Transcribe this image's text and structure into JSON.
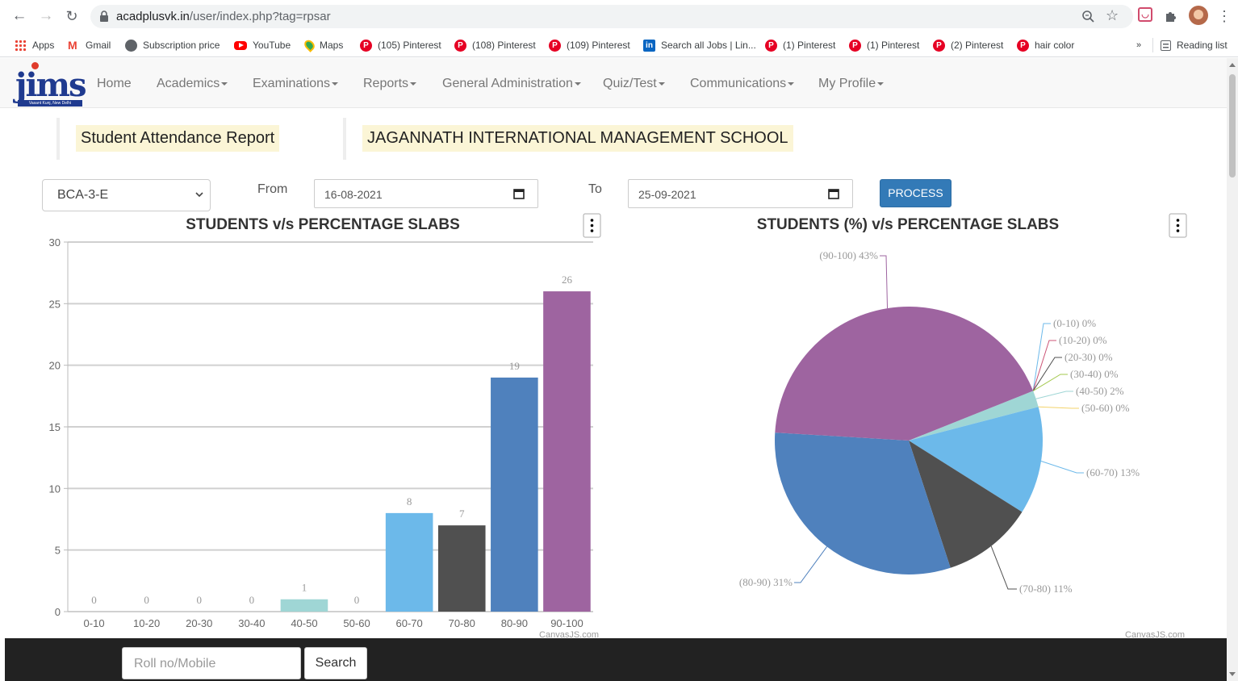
{
  "browser": {
    "url_host": "acadplusvk.in",
    "url_path": "/user/index.php?tag=rpsar",
    "bookmarks": [
      {
        "label": "Apps",
        "icon": "apps-grid-icon"
      },
      {
        "label": "Gmail",
        "icon": "gmail-icon"
      },
      {
        "label": "Subscription price",
        "icon": "globe-icon"
      },
      {
        "label": "YouTube",
        "icon": "youtube-icon"
      },
      {
        "label": "Maps",
        "icon": "maps-pin-icon"
      },
      {
        "label": "(105) Pinterest",
        "icon": "pinterest-icon"
      },
      {
        "label": "(108) Pinterest",
        "icon": "pinterest-icon"
      },
      {
        "label": "(109) Pinterest",
        "icon": "pinterest-icon"
      },
      {
        "label": "Search all Jobs | Lin...",
        "icon": "linkedin-icon"
      },
      {
        "label": "(1) Pinterest",
        "icon": "pinterest-icon"
      },
      {
        "label": "(1) Pinterest",
        "icon": "pinterest-icon"
      },
      {
        "label": "(2) Pinterest",
        "icon": "pinterest-icon"
      },
      {
        "label": "hair color",
        "icon": "pinterest-icon"
      }
    ],
    "overflow": "»",
    "reading_list": "Reading list"
  },
  "logo": {
    "text": "jims",
    "subtitle": "Vasant Kunj, New Delhi"
  },
  "nav": {
    "home": "Home",
    "academics": "Academics",
    "examinations": "Examinations",
    "reports": "Reports",
    "general_admin": "General Administration",
    "quiz": "Quiz/Test",
    "communications": "Communications",
    "profile": "My Profile"
  },
  "header": {
    "report_title": "Student Attendance Report",
    "school_name": "JAGANNATH INTERNATIONAL MANAGEMENT SCHOOL"
  },
  "filters": {
    "class_value": "BCA-3-E",
    "from_label": "From",
    "from_date": "16-08-2021",
    "to_label": "To",
    "to_date": "25-09-2021",
    "process_label": "PROCESS"
  },
  "chart_data": [
    {
      "type": "bar",
      "title": "STUDENTS v/s PERCENTAGE SLABS",
      "categories": [
        "0-10",
        "10-20",
        "20-30",
        "30-40",
        "40-50",
        "50-60",
        "60-70",
        "70-80",
        "80-90",
        "90-100"
      ],
      "values": [
        0,
        0,
        0,
        0,
        1,
        0,
        8,
        7,
        19,
        26
      ],
      "colors": [
        "#6cb9ea",
        "#505050",
        "#4f81bd",
        "#9e64a0",
        "#9fd6d5",
        "#f3d36b",
        "#6cb9ea",
        "#505050",
        "#4f81bd",
        "#9e64a0"
      ],
      "ylim": [
        0,
        30
      ],
      "yticks": [
        0,
        5,
        10,
        15,
        20,
        25,
        30
      ],
      "grid": true,
      "credit": "CanvasJS.com"
    },
    {
      "type": "pie",
      "title": "STUDENTS (%) v/s PERCENTAGE SLABS",
      "labels": [
        "(0-10) 0%",
        "(10-20) 0%",
        "(20-30) 0%",
        "(30-40) 0%",
        "(40-50) 2%",
        "(50-60) 0%",
        "(60-70) 13%",
        "(70-80) 11%",
        "(80-90) 31%",
        "(90-100) 43%"
      ],
      "values": [
        0,
        0,
        0,
        0,
        2,
        0,
        13,
        11,
        31,
        43
      ],
      "colors": [
        "#6cb9ea",
        "#cc5577",
        "#505050",
        "#a3c84d",
        "#9fd6d5",
        "#f3d36b",
        "#6cb9ea",
        "#505050",
        "#4f81bd",
        "#9e64a0"
      ],
      "credit": "CanvasJS.com"
    }
  ],
  "footer": {
    "roll_placeholder": "Roll no/Mobile",
    "search_label": "Search"
  }
}
